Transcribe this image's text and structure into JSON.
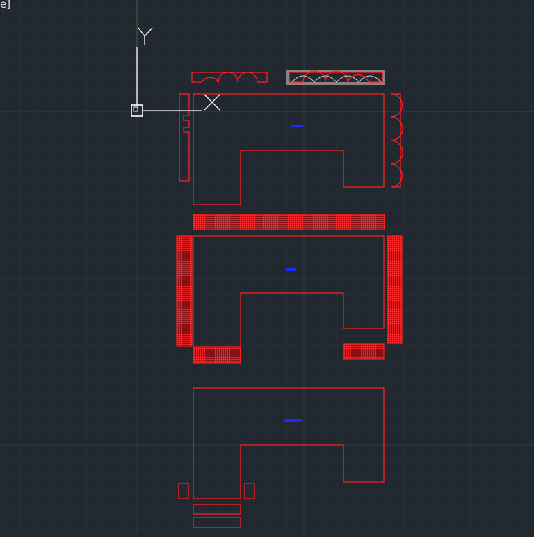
{
  "viewport_label": "e]",
  "ucs": {
    "x_label": "X",
    "y_label": "Y"
  },
  "drawing": {
    "layer_color": "#ff2020",
    "text_color": "#1a2bff",
    "selection_color": "#e6c9c9",
    "x_axis_color": "#7a2a2a",
    "y_axis_color": "#2f6a3a"
  },
  "grid": {
    "minor_color": "#262e38",
    "major_color": "#2f3945"
  }
}
